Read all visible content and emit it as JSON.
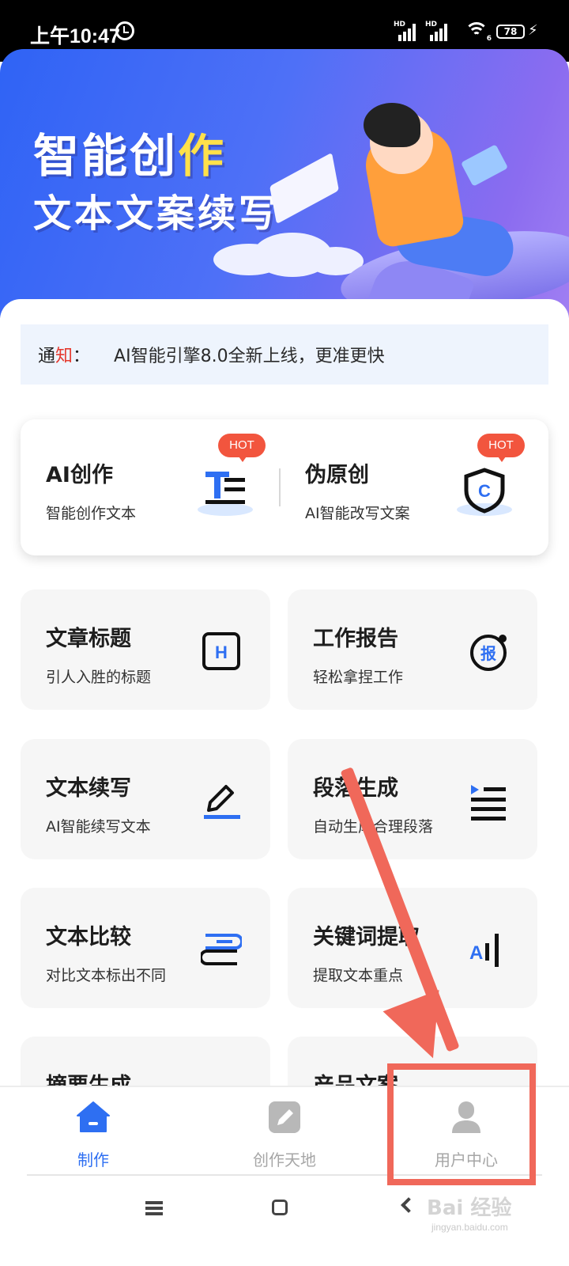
{
  "status_bar": {
    "time": "上午10:47",
    "hd1": "HD",
    "hd2": "HD",
    "wifi_badge": "6",
    "battery": "78",
    "colors": {
      "background": "#000000",
      "text": "#ffffff"
    }
  },
  "banner": {
    "title_line1_part1": "智能创",
    "title_line1_part2": "作",
    "title_line2": "文本文案续写",
    "colors": {
      "gradient_start": "#2f63f5",
      "gradient_end": "#a07ff2",
      "highlight": "#ffe14a"
    }
  },
  "notice": {
    "label_part1": "通",
    "label_part2": "知",
    "colon": "：",
    "text": "AI智能引擎8.0全新上线，更准更快",
    "colors": {
      "label_highlight": "#e53a2f",
      "background": "#eef4fd"
    }
  },
  "featured": [
    {
      "title": "AI创作",
      "subtitle": "智能创作文本",
      "badge": "HOT",
      "icon": "text-format-icon"
    },
    {
      "title": "伪原创",
      "subtitle": "AI智能改写文案",
      "badge": "HOT",
      "icon": "shield-c-icon"
    }
  ],
  "tools": [
    {
      "title": "文章标题",
      "subtitle": "引人入胜的标题",
      "icon": "heading-h-icon"
    },
    {
      "title": "工作报告",
      "subtitle": "轻松拿捏工作",
      "icon": "report-icon"
    },
    {
      "title": "文本续写",
      "subtitle": "AI智能续写文本",
      "icon": "pencil-icon"
    },
    {
      "title": "段落生成",
      "subtitle": "自动生成合理段落",
      "icon": "paragraph-list-icon"
    },
    {
      "title": "文本比较",
      "subtitle": "对比文本标出不同",
      "icon": "stacked-books-icon"
    },
    {
      "title": "关键词提取",
      "subtitle": "提取文本重点",
      "icon": "ai-extract-icon"
    },
    {
      "title": "摘要生成",
      "subtitle": "",
      "icon": "open-book-icon"
    },
    {
      "title": "产品文案",
      "subtitle": "",
      "icon": "chevron-up-icon"
    }
  ],
  "bottom_nav": {
    "items": [
      {
        "label": "制作",
        "icon": "home-icon",
        "active": true
      },
      {
        "label": "创作天地",
        "icon": "edit-icon",
        "active": false
      },
      {
        "label": "用户中心",
        "icon": "user-icon",
        "active": false
      }
    ],
    "colors": {
      "active": "#2e6ff2",
      "inactive": "#a6a6a6"
    }
  },
  "annotation": {
    "color": "#f0685a"
  },
  "watermark": {
    "main": "Bai 经验",
    "sub": "jingyan.baidu.com"
  }
}
